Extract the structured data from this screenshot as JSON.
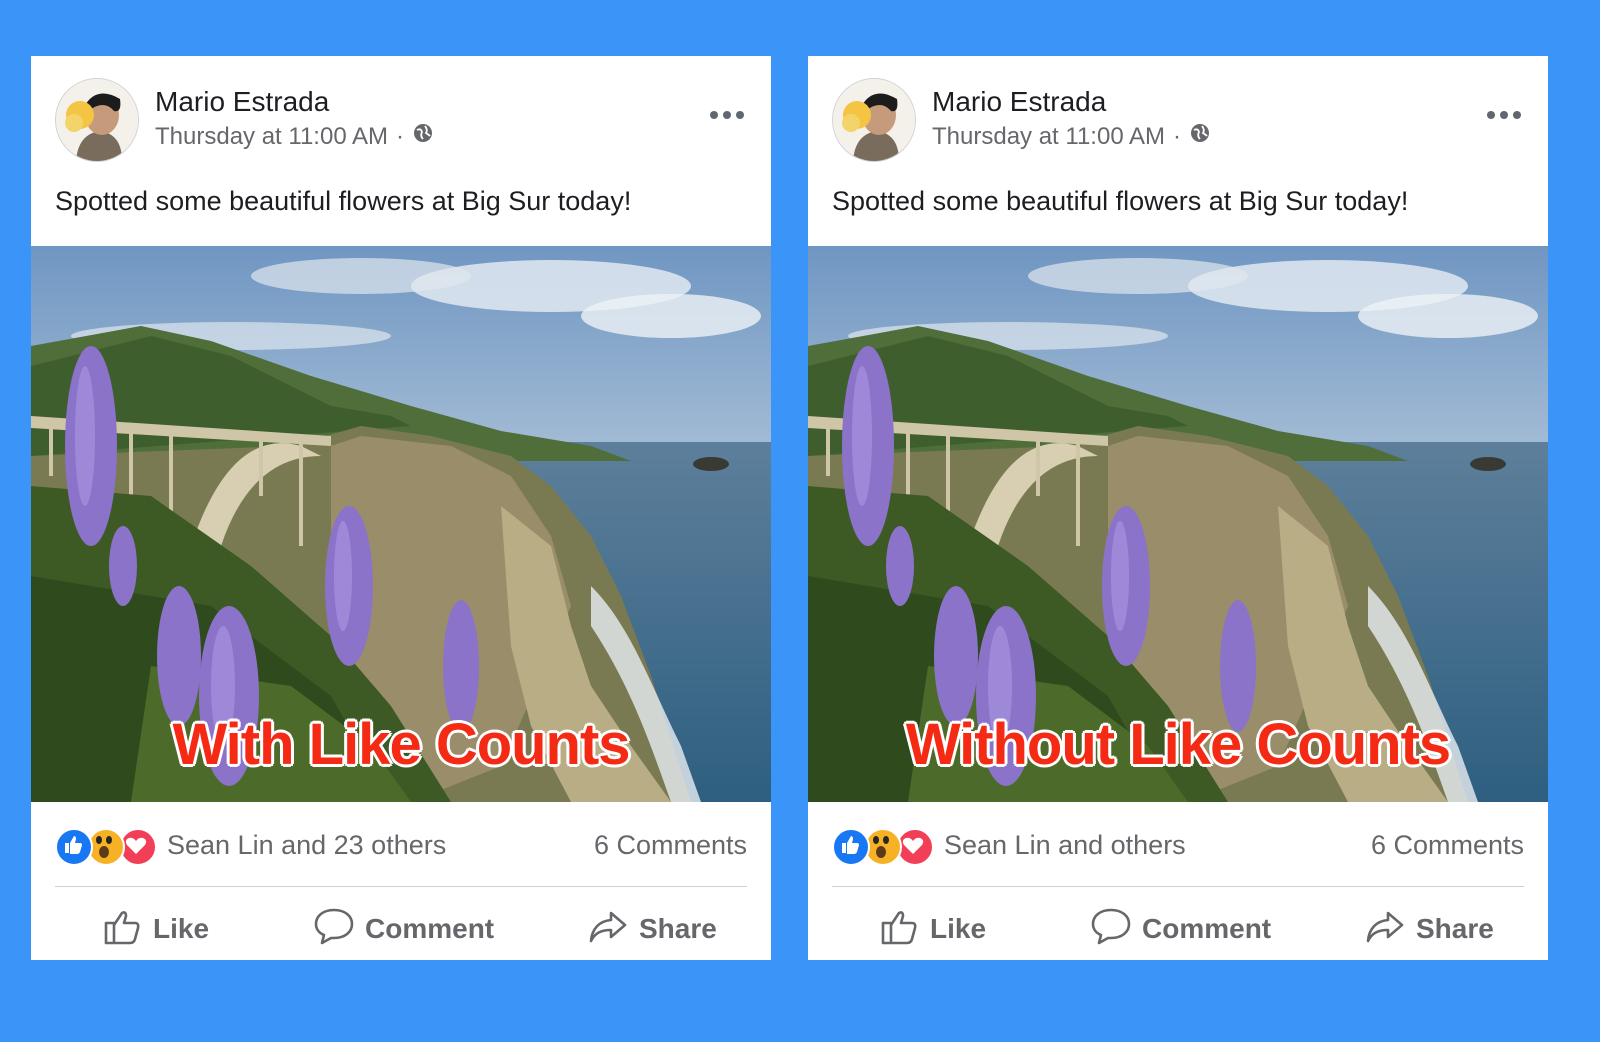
{
  "posts": [
    {
      "author": "Mario Estrada",
      "timestamp": "Thursday at 11:00 AM",
      "separator": "·",
      "caption": "Spotted some beautiful flowers at Big Sur today!",
      "overlay": "With Like Counts",
      "reaction_text": "Sean Lin and 23 others",
      "comments": "6 Comments",
      "actions": {
        "like": "Like",
        "comment": "Comment",
        "share": "Share"
      }
    },
    {
      "author": "Mario Estrada",
      "timestamp": "Thursday at 11:00 AM",
      "separator": "·",
      "caption": "Spotted some beautiful flowers at Big Sur today!",
      "overlay": "Without Like Counts",
      "reaction_text": "Sean Lin and others",
      "comments": "6 Comments",
      "actions": {
        "like": "Like",
        "comment": "Comment",
        "share": "Share"
      }
    }
  ],
  "colors": {
    "background": "#3b94f7",
    "overlay_text": "#f42a15",
    "like_blue": "#1877f2",
    "love_red": "#f33e58",
    "wow_yellow": "#f7b125"
  },
  "icons": [
    "globe-icon",
    "more-options-icon",
    "like-reaction-icon",
    "wow-reaction-icon",
    "love-reaction-icon",
    "thumbs-up-icon",
    "comment-icon",
    "share-icon"
  ]
}
